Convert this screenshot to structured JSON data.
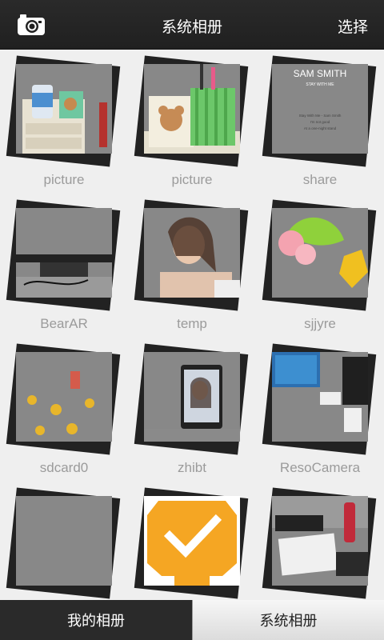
{
  "header": {
    "title": "系统相册",
    "select_label": "选择"
  },
  "albums": [
    {
      "name": "picture"
    },
    {
      "name": "picture"
    },
    {
      "name": "share",
      "art": {
        "line1": "SAM SMITH",
        "line2": "STAY WITH ME",
        "line3": "Stay With Me - Sam Smith",
        "line4": "I'm not good",
        "line5": "At a one-night stand"
      }
    },
    {
      "name": "BearAR"
    },
    {
      "name": "temp"
    },
    {
      "name": "sjjyre"
    },
    {
      "name": "sdcard0"
    },
    {
      "name": "zhibt"
    },
    {
      "name": "ResoCamera"
    },
    {
      "name": ""
    },
    {
      "name": ""
    },
    {
      "name": ""
    }
  ],
  "tabs": [
    {
      "label": "我的相册"
    },
    {
      "label": "系统相册"
    }
  ]
}
